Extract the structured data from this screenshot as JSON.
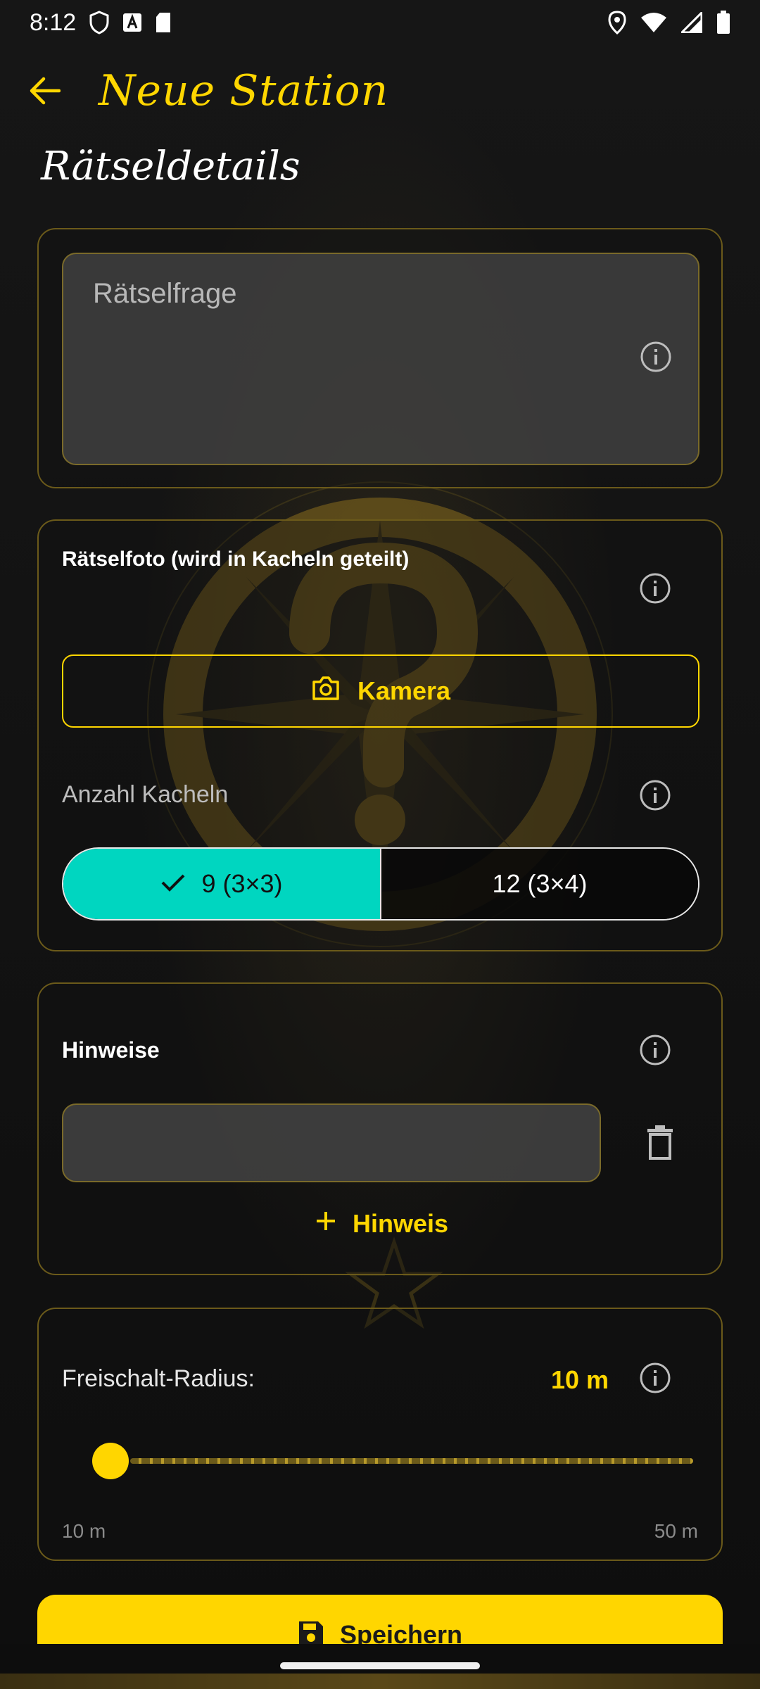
{
  "status_bar": {
    "time": "8:12"
  },
  "app_bar": {
    "title": "Neue Station"
  },
  "section_title": "Rätseldetails",
  "question_card": {
    "label": "Rätselfrage"
  },
  "photo_card": {
    "title": "Rätselfoto (wird in Kacheln geteilt)",
    "camera_label": "Kamera",
    "tiles_label": "Anzahl Kacheln",
    "options": [
      "9 (3×3)",
      "12 (3×4)"
    ],
    "selected_option": "9 (3×3)"
  },
  "hints_card": {
    "title": "Hinweise",
    "add_label": "Hinweis"
  },
  "radius_card": {
    "label": "Freischalt-Radius:",
    "value": "10 m",
    "slider_level": 0,
    "min_label": "10 m",
    "max_label": "50 m"
  },
  "save_label": "Speichern",
  "colors": {
    "accent": "#FFD600",
    "selected": "#00D6C0",
    "border": "#6b5a1a"
  }
}
